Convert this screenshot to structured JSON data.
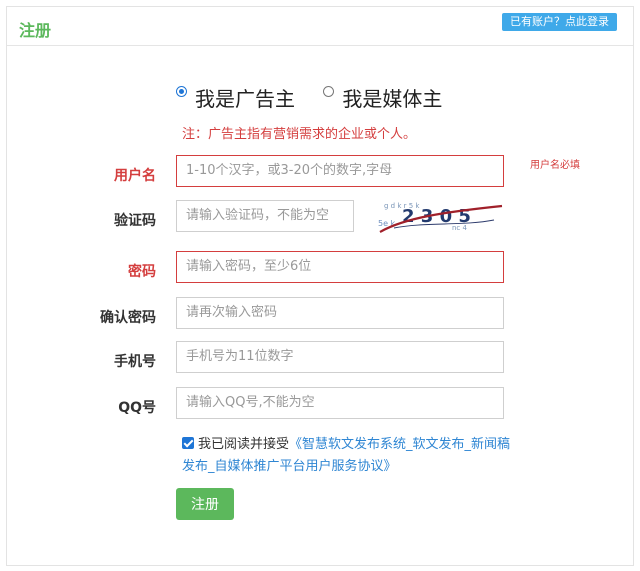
{
  "header": {
    "title": "注册",
    "login_link": "已有账户？点此登录"
  },
  "roles": {
    "advertiser": "我是广告主",
    "media": "我是媒体主",
    "selected": "advertiser"
  },
  "note": "注：广告主指有营销需求的企业或个人。",
  "fields": {
    "username": {
      "label": "用户名",
      "placeholder": "1-10个汉字，或3-20个的数字,字母",
      "error": "用户名必填"
    },
    "captcha": {
      "label": "验证码",
      "placeholder": "请输入验证码，不能为空",
      "image_text": "2 3 0 5"
    },
    "password": {
      "label": "密码",
      "placeholder": "请输入密码，至少6位"
    },
    "confirm_password": {
      "label": "确认密码",
      "placeholder": "请再次输入密码"
    },
    "phone": {
      "label": "手机号",
      "placeholder": "手机号为11位数字"
    },
    "qq": {
      "label": "QQ号",
      "placeholder": "请输入QQ号,不能为空"
    }
  },
  "agreement": {
    "prefix": "我已阅读并接受",
    "link": "《智慧软文发布系统_软文发布_新闻稿发布_自媒体推广平台用户服务协议》",
    "checked": true
  },
  "submit_label": "注册",
  "colors": {
    "accent_green": "#5cb85c",
    "error_red": "#d43e3e",
    "link_blue": "#2f86d3",
    "login_blue": "#3fa9e9"
  }
}
